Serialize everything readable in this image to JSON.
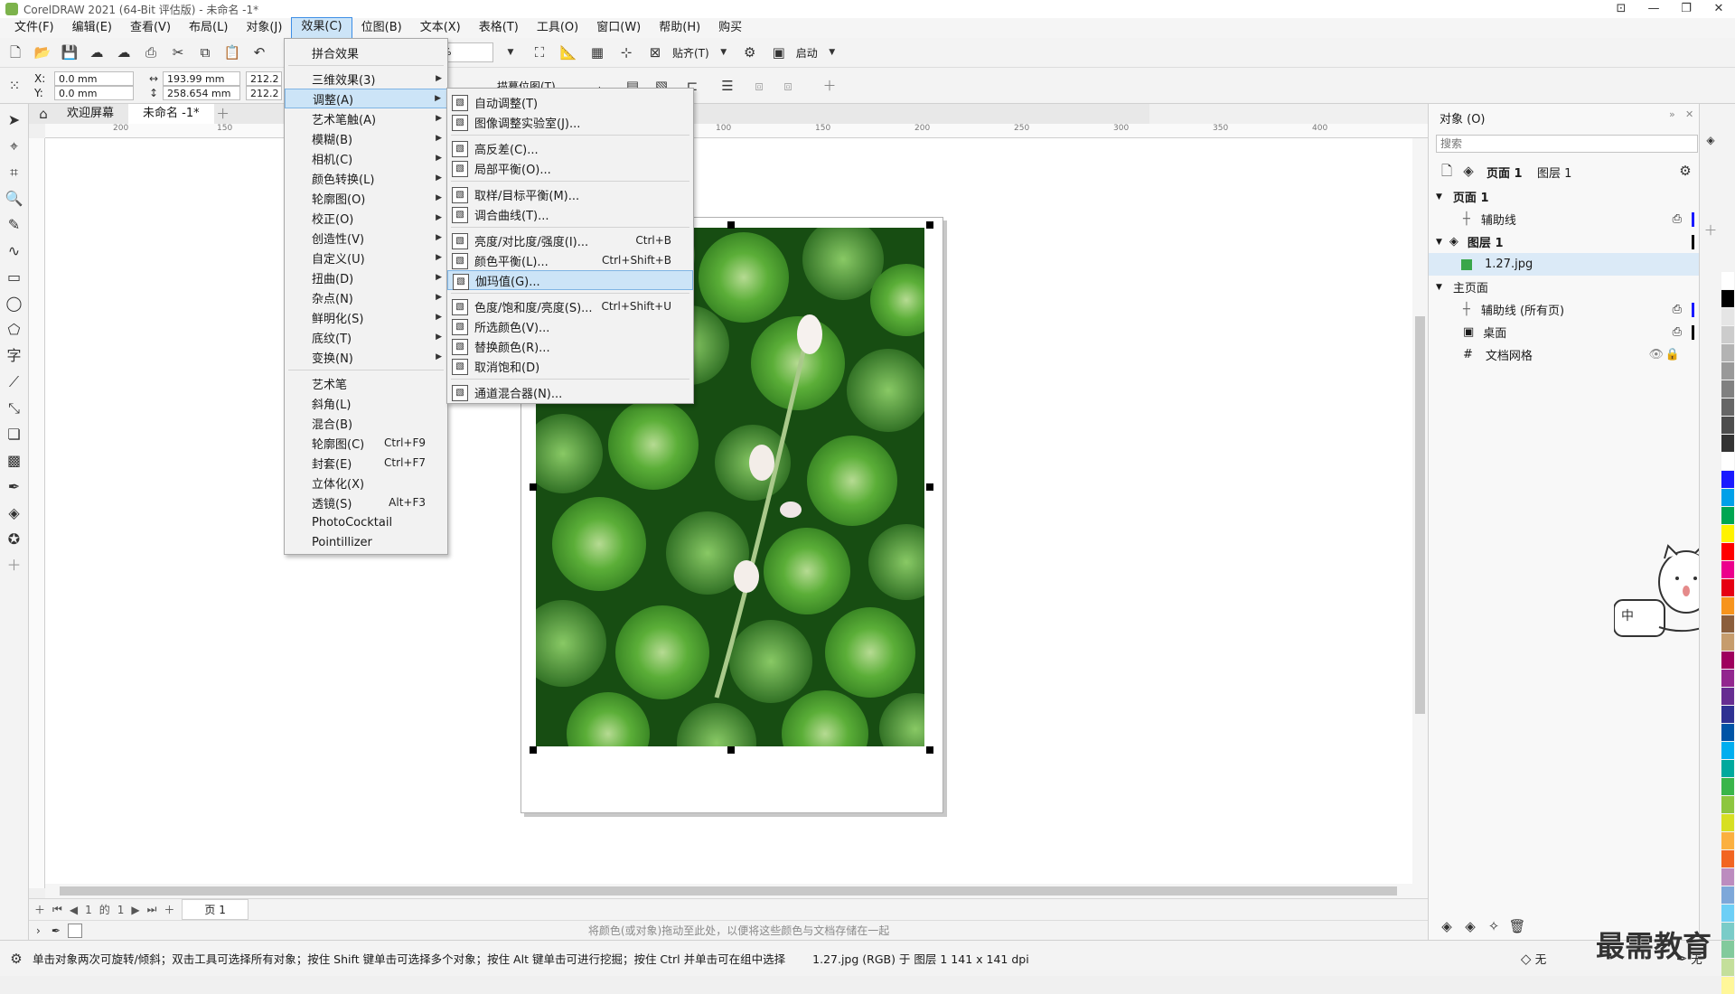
{
  "window": {
    "title": "CorelDRAW 2021 (64-Bit 评估版) - 未命名 -1*"
  },
  "menubar": [
    {
      "label": "文件(F)"
    },
    {
      "label": "编辑(E)"
    },
    {
      "label": "查看(V)"
    },
    {
      "label": "布局(L)"
    },
    {
      "label": "对象(J)"
    },
    {
      "label": "效果(C)",
      "active": true
    },
    {
      "label": "位图(B)"
    },
    {
      "label": "文本(X)"
    },
    {
      "label": "表格(T)"
    },
    {
      "label": "工具(O)"
    },
    {
      "label": "窗口(W)"
    },
    {
      "label": "帮助(H)"
    },
    {
      "label": "购买"
    }
  ],
  "toolbar1": {
    "zoom": "59%",
    "snap_label": "贴齐(T)",
    "launch_label": "启动"
  },
  "toolbar2": {
    "x_label": "X:",
    "x_value": "0.0 mm",
    "y_label": "Y:",
    "y_value": "0.0 mm",
    "w_value": "193.99 mm",
    "h_value": "258.654 mm",
    "sx_value": "212.2",
    "sy_value": "212.2",
    "trace_label": "描摹位图(T)"
  },
  "doc_tabs": {
    "welcome": "欢迎屏幕",
    "document": "未命名 -1*"
  },
  "hruler_ticks": [
    "200",
    "150",
    "100",
    "150",
    "200",
    "250",
    "300",
    "350",
    "400"
  ],
  "effects_menu": [
    {
      "label": "拼合效果",
      "arrow": false
    },
    {
      "sep": true
    },
    {
      "label": "三维效果(3)",
      "arrow": true
    },
    {
      "label": "调整(A)",
      "arrow": true,
      "hl": true
    },
    {
      "label": "艺术笔触(A)",
      "arrow": true
    },
    {
      "label": "模糊(B)",
      "arrow": true
    },
    {
      "label": "相机(C)",
      "arrow": true
    },
    {
      "label": "颜色转换(L)",
      "arrow": true
    },
    {
      "label": "轮廓图(O)",
      "arrow": true
    },
    {
      "label": "校正(O)",
      "arrow": true
    },
    {
      "label": "创造性(V)",
      "arrow": true
    },
    {
      "label": "自定义(U)",
      "arrow": true
    },
    {
      "label": "扭曲(D)",
      "arrow": true
    },
    {
      "label": "杂点(N)",
      "arrow": true
    },
    {
      "label": "鲜明化(S)",
      "arrow": true
    },
    {
      "label": "底纹(T)",
      "arrow": true
    },
    {
      "label": "变换(N)",
      "arrow": true
    },
    {
      "sep": true
    },
    {
      "label": "艺术笔"
    },
    {
      "label": "斜角(L)"
    },
    {
      "label": "混合(B)"
    },
    {
      "label": "轮廓图(C)",
      "shortcut": "Ctrl+F9"
    },
    {
      "label": "封套(E)",
      "shortcut": "Ctrl+F7"
    },
    {
      "label": "立体化(X)"
    },
    {
      "label": "透镜(S)",
      "shortcut": "Alt+F3"
    },
    {
      "label": "PhotoCocktail"
    },
    {
      "label": "Pointillizer"
    }
  ],
  "adjust_submenu": [
    {
      "label": "自动调整(T)",
      "icon": "auto-adjust-icon"
    },
    {
      "label": "图像调整实验室(J)...",
      "icon": "image-lab-icon"
    },
    {
      "sep": true
    },
    {
      "label": "高反差(C)...",
      "icon": "high-contrast-icon"
    },
    {
      "label": "局部平衡(O)...",
      "icon": "local-equalization-icon"
    },
    {
      "sep": true
    },
    {
      "label": "取样/目标平衡(M)...",
      "icon": "sample-target-icon"
    },
    {
      "label": "调合曲线(T)...",
      "icon": "tone-curve-icon"
    },
    {
      "sep": true
    },
    {
      "label": "亮度/对比度/强度(I)...",
      "shortcut": "Ctrl+B",
      "icon": "brightness-icon"
    },
    {
      "label": "颜色平衡(L)...",
      "shortcut": "Ctrl+Shift+B",
      "icon": "color-balance-icon"
    },
    {
      "label": "伽玛值(G)...",
      "icon": "gamma-icon",
      "hl": true
    },
    {
      "sep": true
    },
    {
      "label": "色度/饱和度/亮度(S)...",
      "shortcut": "Ctrl+Shift+U",
      "icon": "hue-saturation-icon"
    },
    {
      "label": "所选颜色(V)...",
      "icon": "selective-color-icon"
    },
    {
      "label": "替换颜色(R)...",
      "icon": "replace-color-icon"
    },
    {
      "label": "取消饱和(D)",
      "icon": "desaturate-icon"
    },
    {
      "sep": true
    },
    {
      "label": "通道混合器(N)...",
      "icon": "channel-mixer-icon"
    }
  ],
  "objects_panel": {
    "title": "对象 (O)",
    "search_placeholder": "搜索",
    "page_label": "页面 1",
    "layer_label": "图层 1",
    "rows": [
      {
        "label": "页面 1",
        "indent": 0,
        "bold": true
      },
      {
        "label": "辅助线",
        "indent": 2
      },
      {
        "label": "图层 1",
        "indent": 1,
        "bold": true
      },
      {
        "label": "1.27.jpg",
        "indent": 3,
        "selected": true
      },
      {
        "label": "主页面",
        "indent": 0
      },
      {
        "label": "辅助线 (所有页)",
        "indent": 2
      },
      {
        "label": "桌面",
        "indent": 2
      },
      {
        "label": "文档网格",
        "indent": 2
      }
    ]
  },
  "page_nav": {
    "current": "1",
    "of": "的",
    "total": "1",
    "tab": "页 1"
  },
  "color_bar": {
    "hint": "将颜色(或对象)拖动至此处，以便将这些颜色与文档存储在一起"
  },
  "status": {
    "hint": "单击对象两次可旋转/倾斜；双击工具可选择所有对象；按住 Shift 键单击可选择多个对象；按住 Alt 键单击可进行挖掘；按住 Ctrl 并单击可在组中选择",
    "info": "1.27.jpg (RGB) 于 图层 1 141 x 141 dpi",
    "fill_label": "无",
    "outline_label": "无"
  },
  "watermark": "最需教育",
  "colors": {
    "accent": "#3d8ee6",
    "menu_highlight": "#cce4f7"
  },
  "palette": [
    "#ffffff",
    "#000000",
    "#e5e5e5",
    "#cccccc",
    "#b3b3b3",
    "#999999",
    "#808080",
    "#666666",
    "#4d4d4d",
    "#333333",
    "#ffffff",
    "#1a1aff",
    "#00a0e9",
    "#00a651",
    "#fff200",
    "#ff0000",
    "#ec008c",
    "#e60012",
    "#f7941d",
    "#8b5e3c",
    "#c69c6d",
    "#9e005d",
    "#92278f",
    "#662d91",
    "#2e3192",
    "#0054a6",
    "#00aeef",
    "#00a99d",
    "#39b54a",
    "#8dc63f",
    "#d7df23",
    "#fbb040",
    "#f26522",
    "#bc8cbf",
    "#7da7d9",
    "#6dcff6",
    "#7accc8",
    "#82ca9c",
    "#c4df9b",
    "#fff799"
  ]
}
